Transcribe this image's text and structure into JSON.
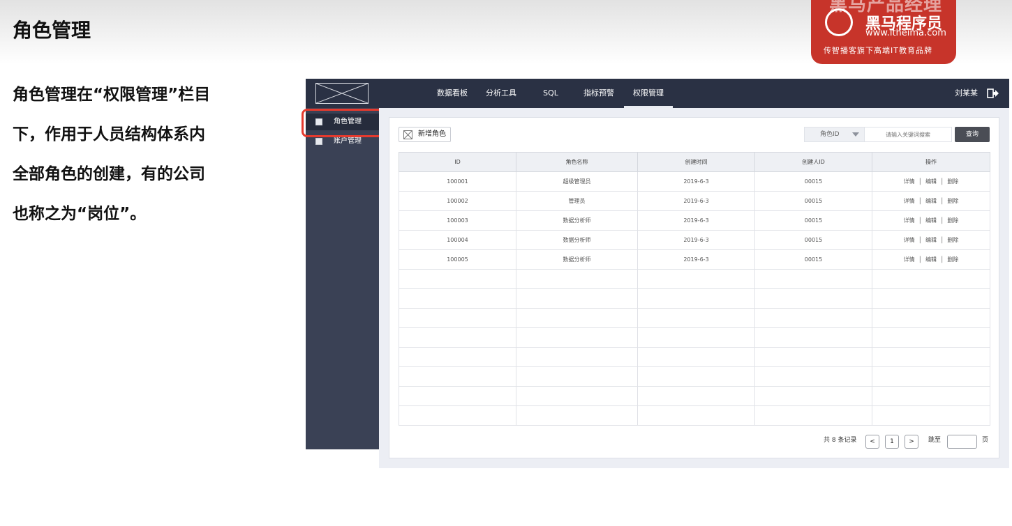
{
  "slide": {
    "title": "角色管理",
    "description_lines": [
      "角色管理在“权限管理”栏目",
      "下，作用于人员结构体系内",
      "全部角色的创建，有的公司",
      "也称之为“岗位”。"
    ]
  },
  "brand": {
    "bigtext": "黑马产品经理",
    "name": "黑马程序员",
    "url": "www.itheima.com",
    "slogan": "传智播客旗下高端IT教育品牌"
  },
  "mockup": {
    "nav": {
      "items": [
        "数据看板",
        "分析工具",
        "SQL",
        "指标预警",
        "权限管理"
      ],
      "active_index": 4,
      "user_name": "刘某某"
    },
    "sidebar": {
      "items": [
        "角色管理",
        "账户管理"
      ],
      "active_index": 0
    },
    "toolbar": {
      "add_label": "新增角色",
      "search_field": "角色ID",
      "search_placeholder": "请输入关键词搜索",
      "query_label": "查询"
    },
    "table": {
      "columns": [
        "ID",
        "角色名称",
        "创建时间",
        "创建人ID",
        "操作"
      ],
      "rows": [
        [
          "100001",
          "超级管理员",
          "2019-6-3",
          "00015"
        ],
        [
          "100002",
          "管理员",
          "2019-6-3",
          "00015"
        ],
        [
          "100003",
          "数据分析师",
          "2019-6-3",
          "00015"
        ],
        [
          "100004",
          "数据分析师",
          "2019-6-3",
          "00015"
        ],
        [
          "100005",
          "数据分析师",
          "2019-6-3",
          "00015"
        ]
      ],
      "actions": [
        "详情",
        "编辑",
        "删除"
      ],
      "empty_rows": 8
    },
    "pagination": {
      "total_text": "共 8 条记录",
      "prev": "<",
      "current_page": "1",
      "next": ">",
      "jump_label": "跳至",
      "jump_value": "",
      "page_unit": "页"
    }
  }
}
